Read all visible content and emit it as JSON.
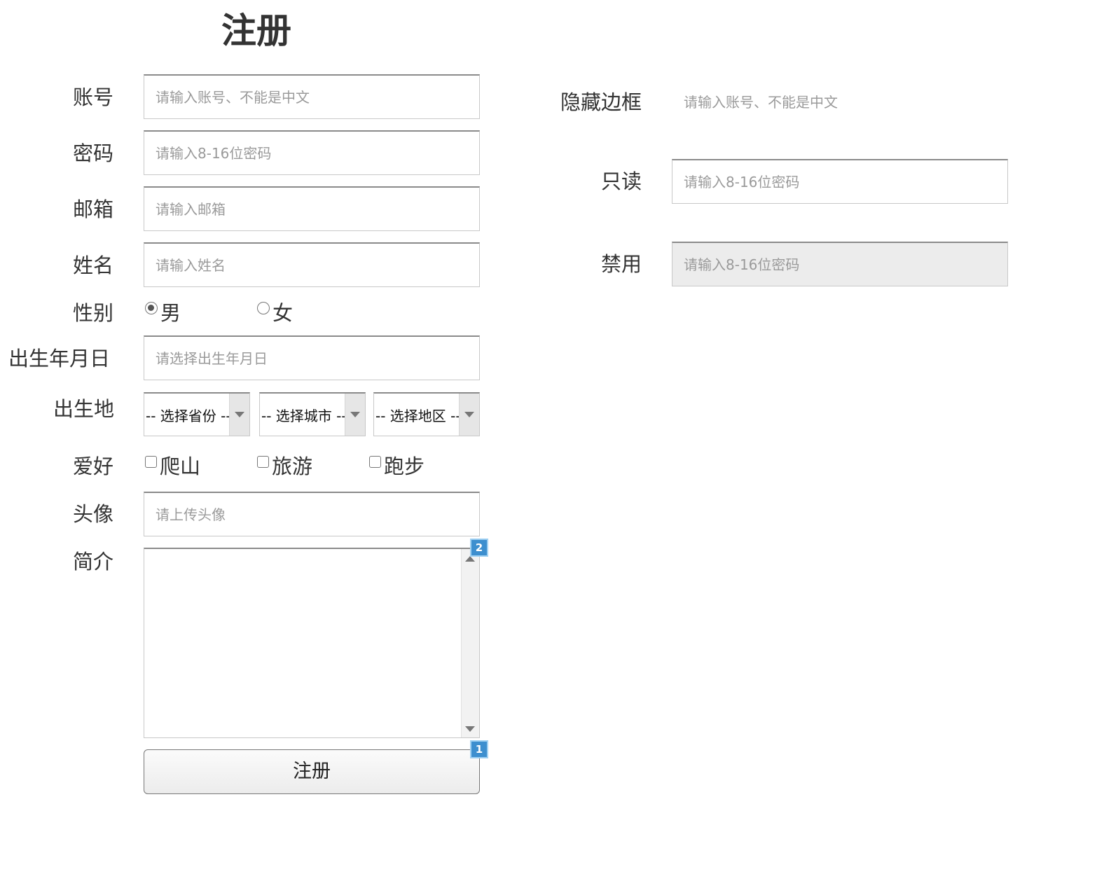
{
  "form": {
    "title": "注册",
    "account": {
      "label": "账号",
      "placeholder": "请输入账号、不能是中文"
    },
    "password": {
      "label": "密码",
      "placeholder": "请输入8-16位密码"
    },
    "email": {
      "label": "邮箱",
      "placeholder": "请输入邮箱"
    },
    "name": {
      "label": "姓名",
      "placeholder": "请输入姓名"
    },
    "gender": {
      "label": "性别",
      "options": [
        {
          "label": "男",
          "checked": true
        },
        {
          "label": "女",
          "checked": false
        }
      ]
    },
    "birthday": {
      "label": "出生年月日",
      "placeholder": "请选择出生年月日"
    },
    "birthplace": {
      "label": "出生地",
      "province": "-- 选择省份 --",
      "city": "-- 选择城市 --",
      "district": "-- 选择地区 --"
    },
    "hobbies": {
      "label": "爱好",
      "options": [
        {
          "label": "爬山",
          "checked": false
        },
        {
          "label": "旅游",
          "checked": false
        },
        {
          "label": "跑步",
          "checked": false
        }
      ]
    },
    "avatar": {
      "label": "头像",
      "placeholder": "请上传头像"
    },
    "bio": {
      "label": "简介",
      "value": ""
    },
    "submit_label": "注册"
  },
  "demo": {
    "hidden_border": {
      "label": "隐藏边框",
      "placeholder": "请输入账号、不能是中文"
    },
    "readonly": {
      "label": "只读",
      "placeholder": "请输入8-16位密码"
    },
    "disabled": {
      "label": "禁用",
      "placeholder": "请输入8-16位密码"
    }
  },
  "badges": {
    "textarea": "2",
    "submit": "1"
  },
  "colors": {
    "badge": "#3d8fcf",
    "disabled_bg": "#ececec"
  }
}
